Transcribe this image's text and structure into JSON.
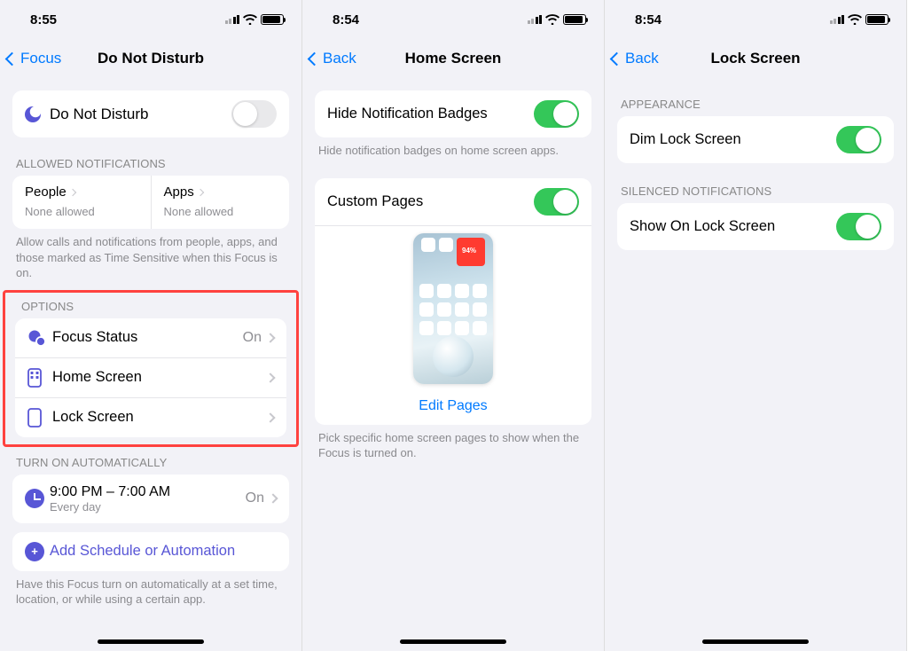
{
  "screens": [
    {
      "status_time": "8:55",
      "nav_back": "Focus",
      "nav_title": "Do Not Disturb",
      "dnd_label": "Do Not Disturb",
      "allowed_header": "ALLOWED NOTIFICATIONS",
      "people_label": "People",
      "people_value": "None allowed",
      "apps_label": "Apps",
      "apps_value": "None allowed",
      "allowed_footer": "Allow calls and notifications from people, apps, and those marked as Time Sensitive when this Focus is on.",
      "options_header": "OPTIONS",
      "focus_status_label": "Focus Status",
      "focus_status_value": "On",
      "home_screen_label": "Home Screen",
      "lock_screen_label": "Lock Screen",
      "auto_header": "TURN ON AUTOMATICALLY",
      "auto_time": "9:00 PM – 7:00 AM",
      "auto_sub": "Every day",
      "auto_value": "On",
      "add_schedule": "Add Schedule or Automation",
      "auto_footer": "Have this Focus turn on automatically at a set time, location, or while using a certain app."
    },
    {
      "status_time": "8:54",
      "nav_back": "Back",
      "nav_title": "Home Screen",
      "hide_badges_label": "Hide Notification Badges",
      "hide_badges_footer": "Hide notification badges on home screen apps.",
      "custom_pages_label": "Custom Pages",
      "edit_pages": "Edit Pages",
      "custom_pages_footer": "Pick specific home screen pages to show when the Focus is turned on."
    },
    {
      "status_time": "8:54",
      "nav_back": "Back",
      "nav_title": "Lock Screen",
      "appearance_header": "APPEARANCE",
      "dim_label": "Dim Lock Screen",
      "silenced_header": "SILENCED NOTIFICATIONS",
      "show_label": "Show On Lock Screen"
    }
  ]
}
